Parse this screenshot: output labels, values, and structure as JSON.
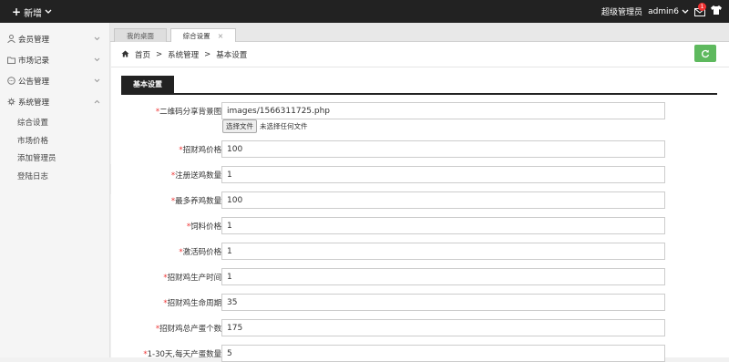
{
  "topbar": {
    "new_label": "新增",
    "user_role": "超级管理员",
    "username": "admin6",
    "mail_badge": "1"
  },
  "sidebar": {
    "items": [
      {
        "label": "会员管理",
        "icon": "user-icon"
      },
      {
        "label": "市场记录",
        "icon": "folder-icon"
      },
      {
        "label": "公告管理",
        "icon": "chat-icon"
      },
      {
        "label": "系统管理",
        "icon": "gear-icon"
      }
    ],
    "sub_items": [
      "综合设置",
      "市场价格",
      "添加管理员",
      "登陆日志"
    ]
  },
  "tabs": [
    {
      "label": "我的桌面"
    },
    {
      "label": "综合设置",
      "close": "×"
    }
  ],
  "breadcrumb": {
    "home": "首页",
    "sep": ">",
    "level1": "系统管理",
    "level2": "基本设置"
  },
  "section_title": "基本设置",
  "form": {
    "required_mark": "*",
    "file_button": "选择文件",
    "file_status": "未选择任何文件",
    "fields": [
      {
        "label": "二维码分享背景图:",
        "value": "images/1566311725.php"
      },
      {
        "label": "招财鸡价格:",
        "value": "100"
      },
      {
        "label": "注册送鸡数量:",
        "value": "1"
      },
      {
        "label": "最多养鸡数量:",
        "value": "100"
      },
      {
        "label": "饲料价格:",
        "value": "1"
      },
      {
        "label": "激活码价格:",
        "value": "1"
      },
      {
        "label": "招财鸡生产时间:",
        "value": "1"
      },
      {
        "label": "招财鸡生命周期:",
        "value": "35"
      },
      {
        "label": "招财鸡总产蛋个数:",
        "value": "175"
      },
      {
        "label": "1-30天,每天产蛋数量:",
        "value": "5"
      }
    ]
  }
}
